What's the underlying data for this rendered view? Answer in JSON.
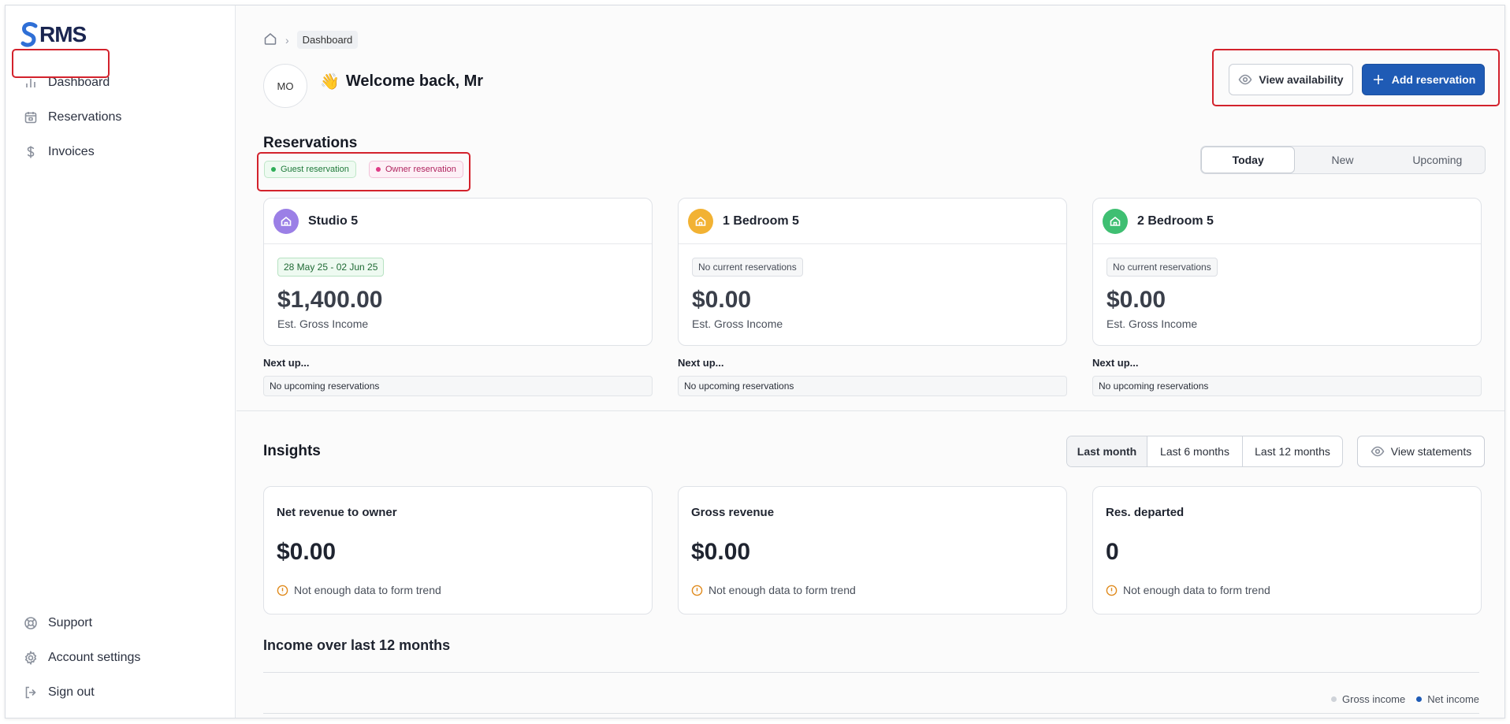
{
  "app": {
    "logo_text": "RMS",
    "logo_mark_color": "#2f6fd6"
  },
  "sidebar": {
    "items": [
      {
        "label": "Dashboard",
        "icon": "bar-chart-icon",
        "active": true
      },
      {
        "label": "Reservations",
        "icon": "calendar-icon"
      },
      {
        "label": "Invoices",
        "icon": "dollar-icon"
      }
    ],
    "bottom_items": [
      {
        "label": "Support",
        "icon": "lifebuoy-icon"
      },
      {
        "label": "Account settings",
        "icon": "gear-icon"
      },
      {
        "label": "Sign out",
        "icon": "sign-out-icon"
      }
    ]
  },
  "breadcrumb": {
    "current": "Dashboard"
  },
  "user": {
    "initials": "MO",
    "welcome": "Welcome back, Mr",
    "wave": "👋"
  },
  "actions": {
    "view_availability": "View availability",
    "add_reservation": "Add reservation"
  },
  "reservations": {
    "title": "Reservations",
    "legend": {
      "guest": "Guest reservation",
      "owner": "Owner reservation"
    },
    "tabs": [
      {
        "label": "Today",
        "active": true
      },
      {
        "label": "New"
      },
      {
        "label": "Upcoming"
      }
    ],
    "properties": [
      {
        "name": "Studio 5",
        "icon_color": "#9b7fe6",
        "badge": "28 May 25 - 02 Jun 25",
        "badge_type": "date",
        "amount": "$1,400.00",
        "amount_label": "Est. Gross Income",
        "next_label": "Next up...",
        "next": "No upcoming reservations"
      },
      {
        "name": "1 Bedroom 5",
        "icon_color": "#f2b233",
        "badge": "No current reservations",
        "badge_type": "none",
        "amount": "$0.00",
        "amount_label": "Est. Gross Income",
        "next_label": "Next up...",
        "next": "No upcoming reservations"
      },
      {
        "name": "2 Bedroom 5",
        "icon_color": "#3fbf72",
        "badge": "No current reservations",
        "badge_type": "none",
        "amount": "$0.00",
        "amount_label": "Est. Gross Income",
        "next_label": "Next up...",
        "next": "No upcoming reservations"
      }
    ]
  },
  "insights": {
    "title": "Insights",
    "ranges": [
      {
        "label": "Last month",
        "active": true
      },
      {
        "label": "Last 6 months"
      },
      {
        "label": "Last 12 months"
      }
    ],
    "view_statements": "View statements",
    "cards": [
      {
        "title": "Net revenue to owner",
        "value": "$0.00",
        "note": "Not enough data to form trend"
      },
      {
        "title": "Gross revenue",
        "value": "$0.00",
        "note": "Not enough data to form trend"
      },
      {
        "title": "Res. departed",
        "value": "0",
        "note": "Not enough data to form trend"
      }
    ]
  },
  "income": {
    "title": "Income over last 12 months",
    "legend": [
      {
        "label": "Gross income",
        "color": "#cfd3d9"
      },
      {
        "label": "Net income",
        "color": "#1f5bb5"
      }
    ]
  }
}
